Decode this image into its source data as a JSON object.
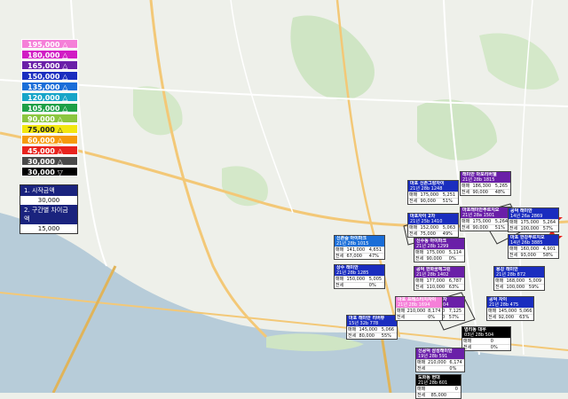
{
  "legend": [
    {
      "label": "195,000 △",
      "bg": "#f57fd8",
      "fg": "#ffffff"
    },
    {
      "label": "180,000 △",
      "bg": "#d11bc4",
      "fg": "#ffffff"
    },
    {
      "label": "165,000 △",
      "bg": "#6a1fa8",
      "fg": "#ffffff"
    },
    {
      "label": "150,000 △",
      "bg": "#1a2dbf",
      "fg": "#ffffff"
    },
    {
      "label": "135,000 △",
      "bg": "#1a6ed8",
      "fg": "#ffffff"
    },
    {
      "label": "120,000 △",
      "bg": "#17a5c8",
      "fg": "#ffffff"
    },
    {
      "label": "105,000 △",
      "bg": "#1ea047",
      "fg": "#ffffff"
    },
    {
      "label": "90,000 △",
      "bg": "#8cc63f",
      "fg": "#ffffff"
    },
    {
      "label": "75,000 △",
      "bg": "#f2e60f",
      "fg": "#222222"
    },
    {
      "label": "60,000 △",
      "bg": "#f59a0c",
      "fg": "#ffffff"
    },
    {
      "label": "45,000 △",
      "bg": "#e8231e",
      "fg": "#ffffff"
    },
    {
      "label": "30,000 △",
      "bg": "#4a4a4a",
      "fg": "#ffffff"
    },
    {
      "label": "30,000 ▽",
      "bg": "#000000",
      "fg": "#ffffff"
    }
  ],
  "gap_box": {
    "start_label": "1. 시작금액",
    "start_value": "30,000",
    "step_label": "2. 구간별 차이금액",
    "step_value": "15,000"
  },
  "cards": [
    {
      "name": "card-1",
      "color": "#6a1fa8",
      "title": "래미안 마포리버웰",
      "sub": "21년 28b 1815",
      "rows": [
        [
          "매매",
          "186,300",
          "5,265"
        ],
        [
          "전세",
          "90,000",
          "48%"
        ]
      ]
    },
    {
      "name": "card-2",
      "color": "#6a1fa8",
      "title": "마포래미안푸르지오",
      "sub": "21년 28a 1501",
      "rows": [
        [
          "매매",
          "175,000",
          "5,264"
        ],
        [
          "전세",
          "90,000",
          "51%"
        ]
      ]
    },
    {
      "name": "card-3",
      "color": "#1a2dbf",
      "title": "마포 신촌그랑자이",
      "sub": "21년 28b 1248",
      "rows": [
        [
          "매매",
          "175,000",
          "5,251"
        ],
        [
          "전세",
          "90,000",
          "51%"
        ]
      ]
    },
    {
      "name": "card-4",
      "color": "#1a2dbf",
      "title": "마포자이 2차",
      "sub": "21년 25b 1410",
      "rows": [
        [
          "매매",
          "152,000",
          "5,063"
        ],
        [
          "전세",
          "75,000",
          "49%"
        ]
      ]
    },
    {
      "name": "card-5",
      "color": "#1a6ed8",
      "title": "신촌숲 아이파크",
      "sub": "21년 28b 1015",
      "rows": [
        [
          "매매",
          "141,000",
          "4,651"
        ],
        [
          "전세",
          "67,000",
          "47%"
        ]
      ]
    },
    {
      "name": "card-6",
      "color": "#1a2dbf",
      "title": "공덕 래미안",
      "sub": "14년 26a 2869",
      "rows": [
        [
          "매매",
          "175,000",
          "5,264"
        ],
        [
          "전세",
          "100,000",
          "57%"
        ]
      ]
    },
    {
      "name": "card-7",
      "color": "#1a2dbf",
      "title": "마포 한강푸르지오",
      "sub": "14년 26b 3885",
      "rows": [
        [
          "매매",
          "160,000",
          "4,901"
        ],
        [
          "전세",
          "93,000",
          "58%"
        ]
      ]
    },
    {
      "name": "card-8",
      "color": "#6a1fa8",
      "title": "신수동 아이파크",
      "sub": "21년 28b 1299",
      "rows": [
        [
          "매매",
          "175,000",
          "5,114"
        ],
        [
          "전세",
          "90,000",
          "0%"
        ]
      ]
    },
    {
      "name": "card-9",
      "color": "#1a2dbf",
      "title": "상수 래미안",
      "sub": "21년 28b 1285",
      "rows": [
        [
          "매매",
          "150,000",
          "5,005"
        ],
        [
          "전세",
          "",
          "0%"
        ]
      ]
    },
    {
      "name": "card-10",
      "color": "#6a1fa8",
      "title": "공덕 한화꿈에그린",
      "sub": "21년 28b 1402",
      "rows": [
        [
          "매매",
          "177,000",
          "6,787"
        ],
        [
          "전세",
          "110,000",
          "63%"
        ]
      ]
    },
    {
      "name": "card-11",
      "color": "#6a1fa8",
      "title": "공덕 래미안 5차",
      "sub": "21년 28b 1804",
      "rows": [
        [
          "매매",
          "175,000",
          "7,125"
        ],
        [
          "전세",
          "100,000",
          "57%"
        ]
      ]
    },
    {
      "name": "card-12",
      "color": "#1a2dbf",
      "title": "용강 래미안",
      "sub": "21년 28b 872",
      "rows": [
        [
          "매매",
          "168,000",
          "5,009"
        ],
        [
          "전세",
          "100,000",
          "59%"
        ]
      ]
    },
    {
      "name": "card-13",
      "color": "#1a2dbf",
      "title": "공덕 자이",
      "sub": "21년 28b 475",
      "rows": [
        [
          "매매",
          "145,000",
          "5,066"
        ],
        [
          "전세",
          "92,000",
          "63%"
        ]
      ]
    },
    {
      "name": "card-14",
      "color": "#1a2dbf",
      "title": "마포 래미안 리버뷰",
      "sub": "15년 32b 778",
      "rows": [
        [
          "매매",
          "145,000",
          "5,066"
        ],
        [
          "전세",
          "80,000",
          "55%"
        ]
      ]
    },
    {
      "name": "card-15",
      "color": "#f57fd8",
      "title": "마포 프레스티지자이",
      "sub": "21년 28b 1694",
      "rows": [
        [
          "매매",
          "210,000",
          "8,174"
        ],
        [
          "전세",
          "",
          "0%"
        ]
      ]
    },
    {
      "name": "card-16",
      "color": "#000000",
      "title": "염리동 대우",
      "sub": "03년 28b 504",
      "rows": [
        [
          "매매",
          "",
          "0"
        ],
        [
          "전세",
          "",
          "0%"
        ]
      ]
    },
    {
      "name": "card-17",
      "color": "#6a1fa8",
      "title": "신공덕 삼성래미안",
      "sub": "19년 28b 591",
      "rows": [
        [
          "매매",
          "210,000",
          "6,174"
        ],
        [
          "전세",
          "",
          "0%"
        ]
      ]
    },
    {
      "name": "card-18",
      "color": "#000000",
      "title": "도화동 현대",
      "sub": "21년 28b 601",
      "rows": [
        [
          "매매",
          "",
          "0"
        ],
        [
          "전세",
          "85,000",
          ""
        ]
      ]
    }
  ]
}
